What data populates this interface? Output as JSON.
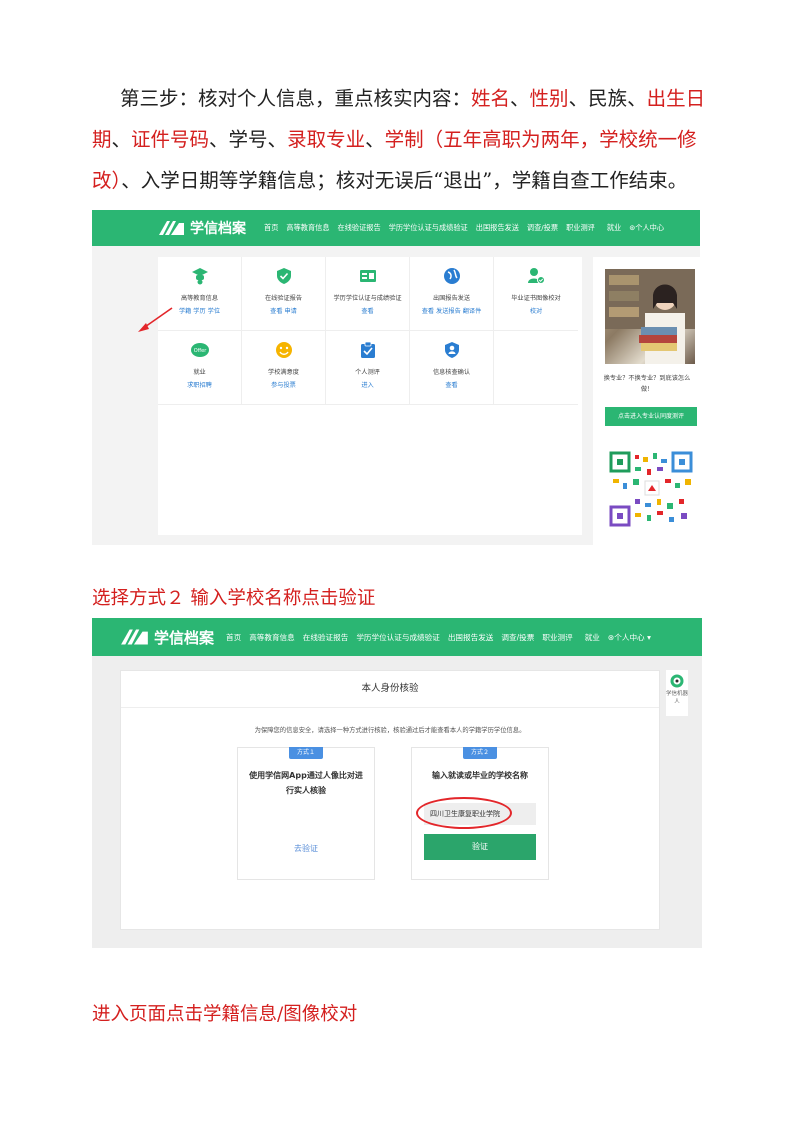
{
  "paragraph": {
    "p1": "第三步：核对个人信息，重点核实内容：",
    "r1": "姓名",
    "p2": "、",
    "r2": "性别",
    "p3": "、民族、",
    "r3": "出生日期",
    "p4": "、",
    "r4": "证件号码",
    "p5": "、学号、",
    "r5": "录取专业",
    "p6": "、",
    "r6": "学制（五年高职为两年，学校统一修改）",
    "p7": "、入学日期等学籍信息；核对无误后“退出”，学籍自查工作结束。"
  },
  "screenshot1": {
    "logo_text": "学信档案",
    "nav": [
      "首页",
      "高等教育信息",
      "在线验证报告",
      "学历学位认证与成绩验证",
      "出国报告发送",
      "调查/投票",
      "职业测评",
      "就业",
      "个人中心"
    ],
    "cells": [
      {
        "title": "高等教育信息",
        "links": "学籍   学历   学位",
        "icon": "graduate-icon"
      },
      {
        "title": "在线验证报告",
        "links": "查看   申请",
        "icon": "shield-check-icon"
      },
      {
        "title": "学历学位认证与成绩验证",
        "links": "查看",
        "icon": "certificate-icon"
      },
      {
        "title": "出国报告发送",
        "links": "查看   发送报告   翻译件",
        "icon": "globe-icon"
      },
      {
        "title": "毕业证书图像校对",
        "links": "校对",
        "icon": "user-check-icon"
      },
      {
        "title": "就业",
        "links": "求职招聘",
        "icon": "offer-icon"
      },
      {
        "title": "学校满意度",
        "links": "参与投票",
        "icon": "smile-icon"
      },
      {
        "title": "个人测评",
        "links": "进入",
        "icon": "clipboard-check-icon"
      },
      {
        "title": "信息核查确认",
        "links": "查看",
        "icon": "user-shield-icon"
      }
    ],
    "side_text": "换专业？不换专业？到底该怎么做！",
    "side_button": "点击进入专业认同度测评"
  },
  "heading1": "选择方式２ 输入学校名称点击验证",
  "screenshot2": {
    "logo_text": "学信档案",
    "nav": [
      "首页",
      "高等教育信息",
      "在线验证报告",
      "学历学位认证与成绩验证",
      "出国报告发送",
      "调查/投票",
      "职业测评",
      "就业",
      "个人中心 ▾"
    ],
    "panel_title": "本人身份核验",
    "notice": "为保障您的信息安全，请选择一种方式进行核验，核验通过后才能查看本人的学籍学历学位信息。",
    "method1": {
      "tag": "方式１",
      "title": "使用学信网App通过人像比对进行实人核验",
      "link": "去验证"
    },
    "method2": {
      "tag": "方式２",
      "title": "输入就读或毕业的学校名称",
      "school": "四川卫生康复职业学院",
      "button": "验证"
    },
    "robot_label": "学信机器人"
  },
  "heading2": "进入页面点击学籍信息/图像校对",
  "colors": {
    "brand_green": "#2bb673",
    "red": "#d4201f",
    "link_blue": "#2a7dd1"
  }
}
